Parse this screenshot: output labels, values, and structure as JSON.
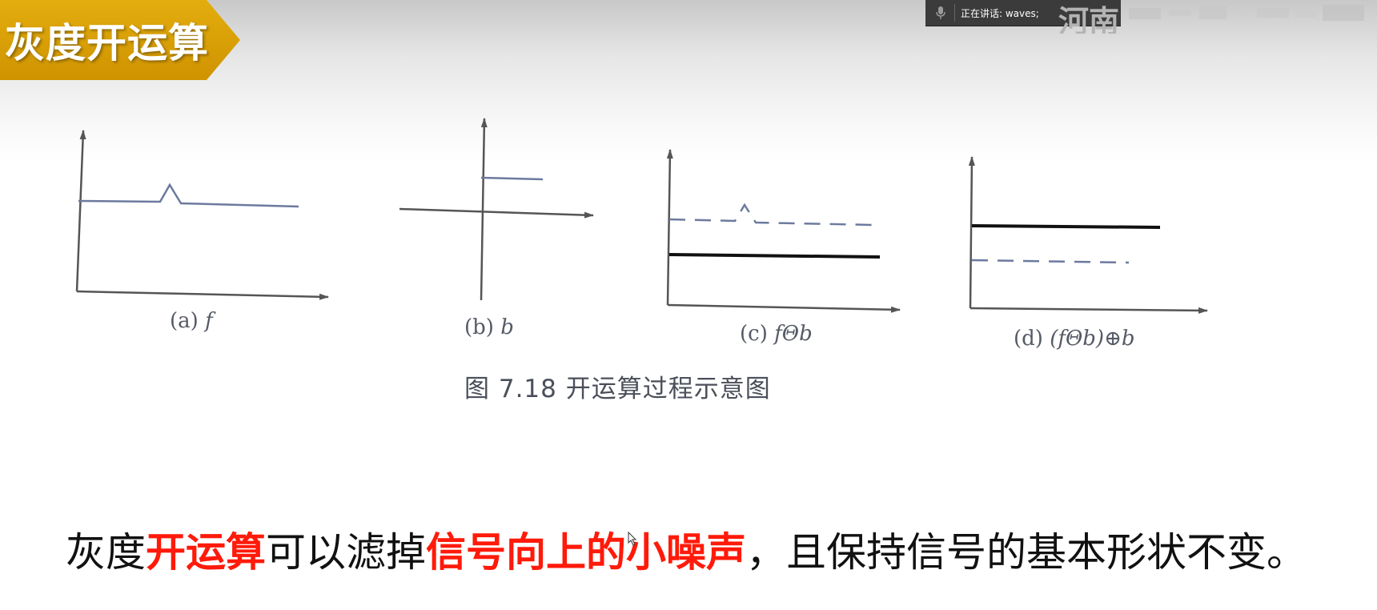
{
  "slide": {
    "title": "灰度开运算",
    "accent_color": "#d99e06",
    "highlight_color": "#ff1a0a"
  },
  "speaking_indicator": {
    "icon": "microphone-icon",
    "text": "正在讲话: waves;"
  },
  "watermark": {
    "text": "河南"
  },
  "figure": {
    "caption": "图 7.18  开运算过程示意图",
    "panels": [
      {
        "label_prefix": "(a) ",
        "label_math": "f"
      },
      {
        "label_prefix": "(b) ",
        "label_math": "b"
      },
      {
        "label_prefix": "(c) ",
        "label_math": "fΘb"
      },
      {
        "label_prefix": "(d) ",
        "label_math": "(fΘb)⊕b"
      }
    ]
  },
  "sentence": {
    "part1": "灰度",
    "highlight1": "开运算",
    "part2": "可以滤掉",
    "highlight2": "信号向上的小噪声",
    "part3": "，且保持信号的基本形状不变。"
  }
}
